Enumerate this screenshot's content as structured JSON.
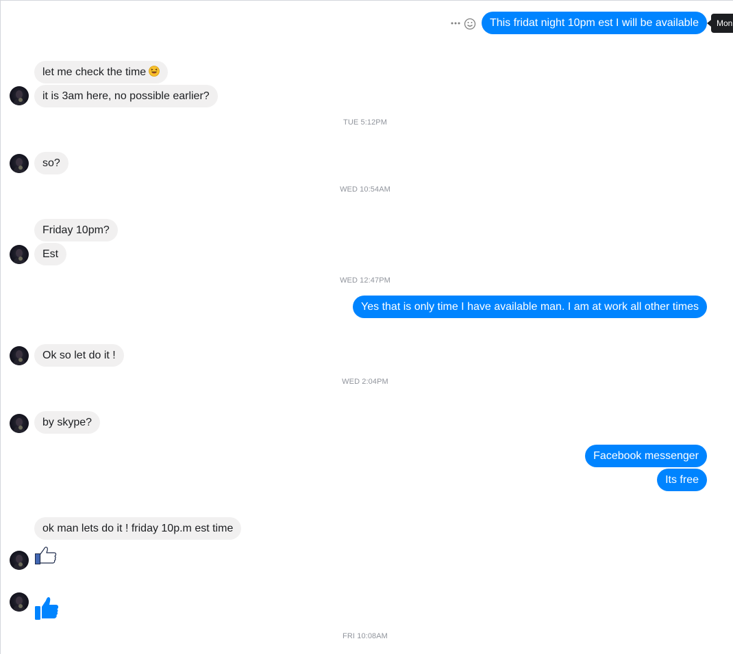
{
  "tooltip": {
    "label": "Mon"
  },
  "messages": {
    "m1": {
      "text": "This fridat night 10pm est I will be available",
      "sender": "me"
    },
    "m2": {
      "text": "let me check the time",
      "sender": "contact"
    },
    "m3": {
      "text": "it is 3am here, no possible earlier?",
      "sender": "contact"
    },
    "m4": {
      "text": "so?",
      "sender": "contact"
    },
    "m5": {
      "text": "Friday 10pm?",
      "sender": "contact"
    },
    "m6": {
      "text": "Est",
      "sender": "contact"
    },
    "m7": {
      "text": "Yes that is only time I have available man. I am at work all other times",
      "sender": "me"
    },
    "m8": {
      "text": "Ok so let do it !",
      "sender": "contact"
    },
    "m9": {
      "text": "by skype?",
      "sender": "contact"
    },
    "m10": {
      "text": "Facebook messenger",
      "sender": "me"
    },
    "m11": {
      "text": "Its free",
      "sender": "me"
    },
    "m12": {
      "text": "ok man lets do it ! friday 10p.m est time",
      "sender": "contact"
    }
  },
  "timestamps": {
    "t1": "TUE 5:12PM",
    "t2": "WED 10:54AM",
    "t3": "WED 12:47PM",
    "t4": "WED 2:04PM",
    "t5": "FRI 10:08AM"
  },
  "icons": {
    "more": "more-options-icon",
    "react": "smiley-react-icon",
    "emoji": "laughing-emoji-icon",
    "like_outline": "thumbs-up-outline-icon",
    "like_filled": "thumbs-up-filled-icon"
  },
  "colors": {
    "outgoing_bubble": "#0084ff",
    "incoming_bubble": "#f1f0f0",
    "timestamp": "#90949c",
    "like_blue": "#0084ff"
  }
}
